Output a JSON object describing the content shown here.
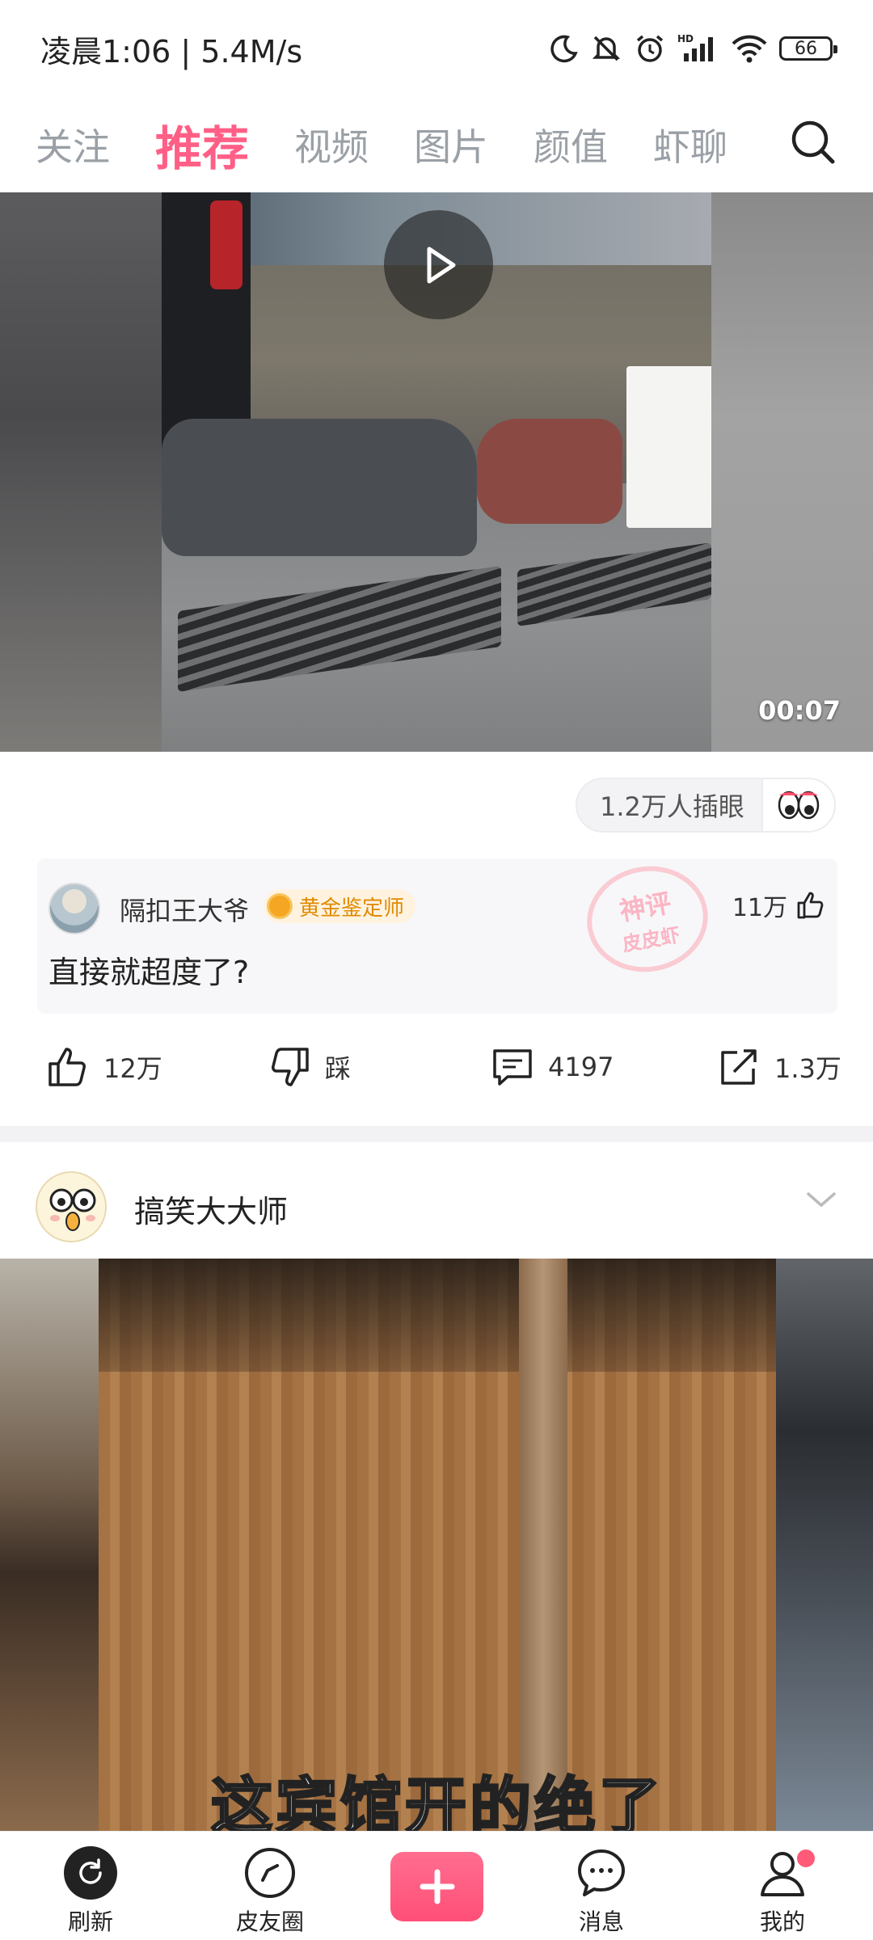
{
  "status_bar": {
    "time_speed": "凌晨1:06 | 5.4M/s",
    "battery": "66"
  },
  "tabs": [
    {
      "label": "关注"
    },
    {
      "label": "推荐",
      "active": true
    },
    {
      "label": "视频"
    },
    {
      "label": "图片"
    },
    {
      "label": "颜值"
    },
    {
      "label": "虾聊"
    }
  ],
  "post1": {
    "duration": "00:07",
    "insert_eye": "1.2万人插眼",
    "god_comment": {
      "user": "隔扣王大爷",
      "badge": "黄金鉴定师",
      "stamp_line1": "神评",
      "stamp_line2": "皮皮虾",
      "likes": "11万",
      "text": "直接就超度了?"
    },
    "actions": {
      "like": "12万",
      "dislike": "踩",
      "comments": "4197",
      "share": "1.3万"
    }
  },
  "post2": {
    "author": "搞笑大大师",
    "subtitle": "这宾馆开的绝了"
  },
  "bottom_nav": [
    {
      "label": "刷新"
    },
    {
      "label": "皮友圈"
    },
    {
      "label": "消息"
    },
    {
      "label": "我的"
    }
  ],
  "colors": {
    "accent": "#ff5f86",
    "badge_gold": "#e08a00"
  }
}
